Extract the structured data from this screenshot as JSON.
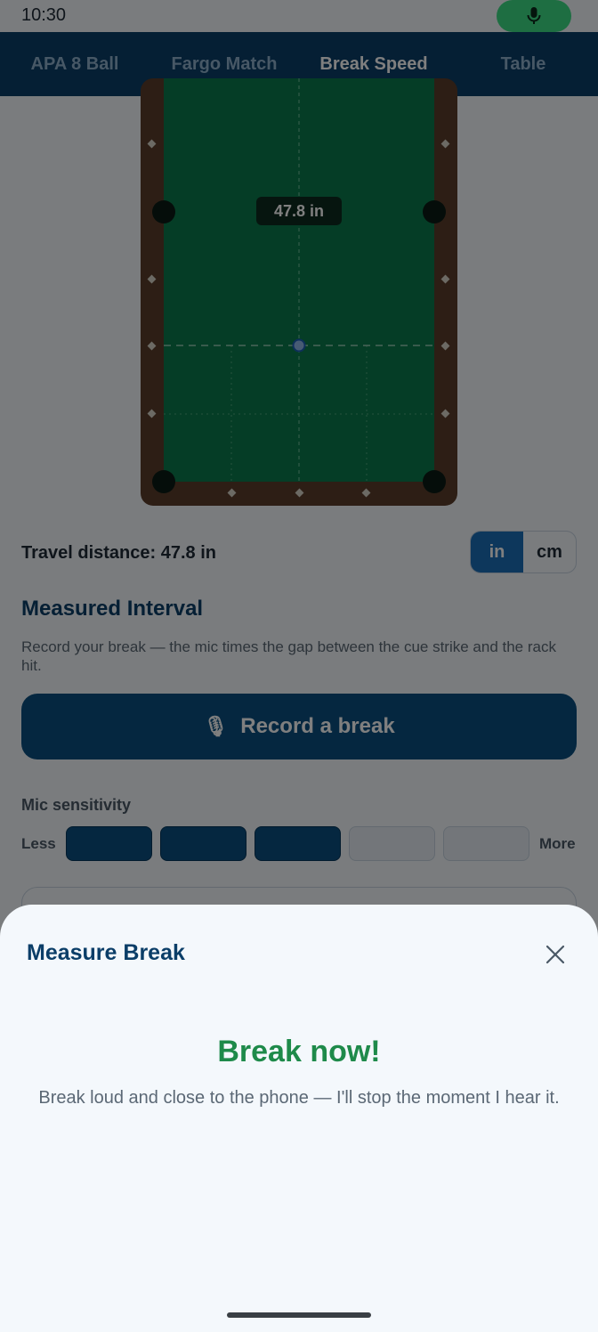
{
  "status_bar": {
    "time": "10:30"
  },
  "tabs": [
    {
      "label": "APA 8 Ball",
      "active": false
    },
    {
      "label": "Fargo Match",
      "active": false
    },
    {
      "label": "Break Speed",
      "active": true
    },
    {
      "label": "Table",
      "active": false
    }
  ],
  "table_diagram": {
    "distance_label": "47.8 in"
  },
  "travel": {
    "text": "Travel distance: 47.8 in"
  },
  "units": {
    "options": [
      "in",
      "cm"
    ],
    "selected": "in"
  },
  "interval": {
    "title": "Measured Interval",
    "description": "Record your break — the mic times the gap between the cue strike and the rack hit.",
    "record_button_icon": "🎙",
    "record_button_label": "Record a break"
  },
  "sensitivity": {
    "label": "Mic sensitivity",
    "less_label": "Less",
    "more_label": "More",
    "level": 3,
    "max_level": 5
  },
  "sheet": {
    "title": "Measure Break",
    "headline": "Break now!",
    "message": "Break loud and close to the phone — I'll stop the moment I hear it."
  },
  "colors": {
    "header_bg": "#0b3e68",
    "accent": "#1a6fb8",
    "felt": "#0b7a4d",
    "rail": "#5a3d2b",
    "success": "#1e8a4a",
    "mic_active": "#3ddc84"
  }
}
